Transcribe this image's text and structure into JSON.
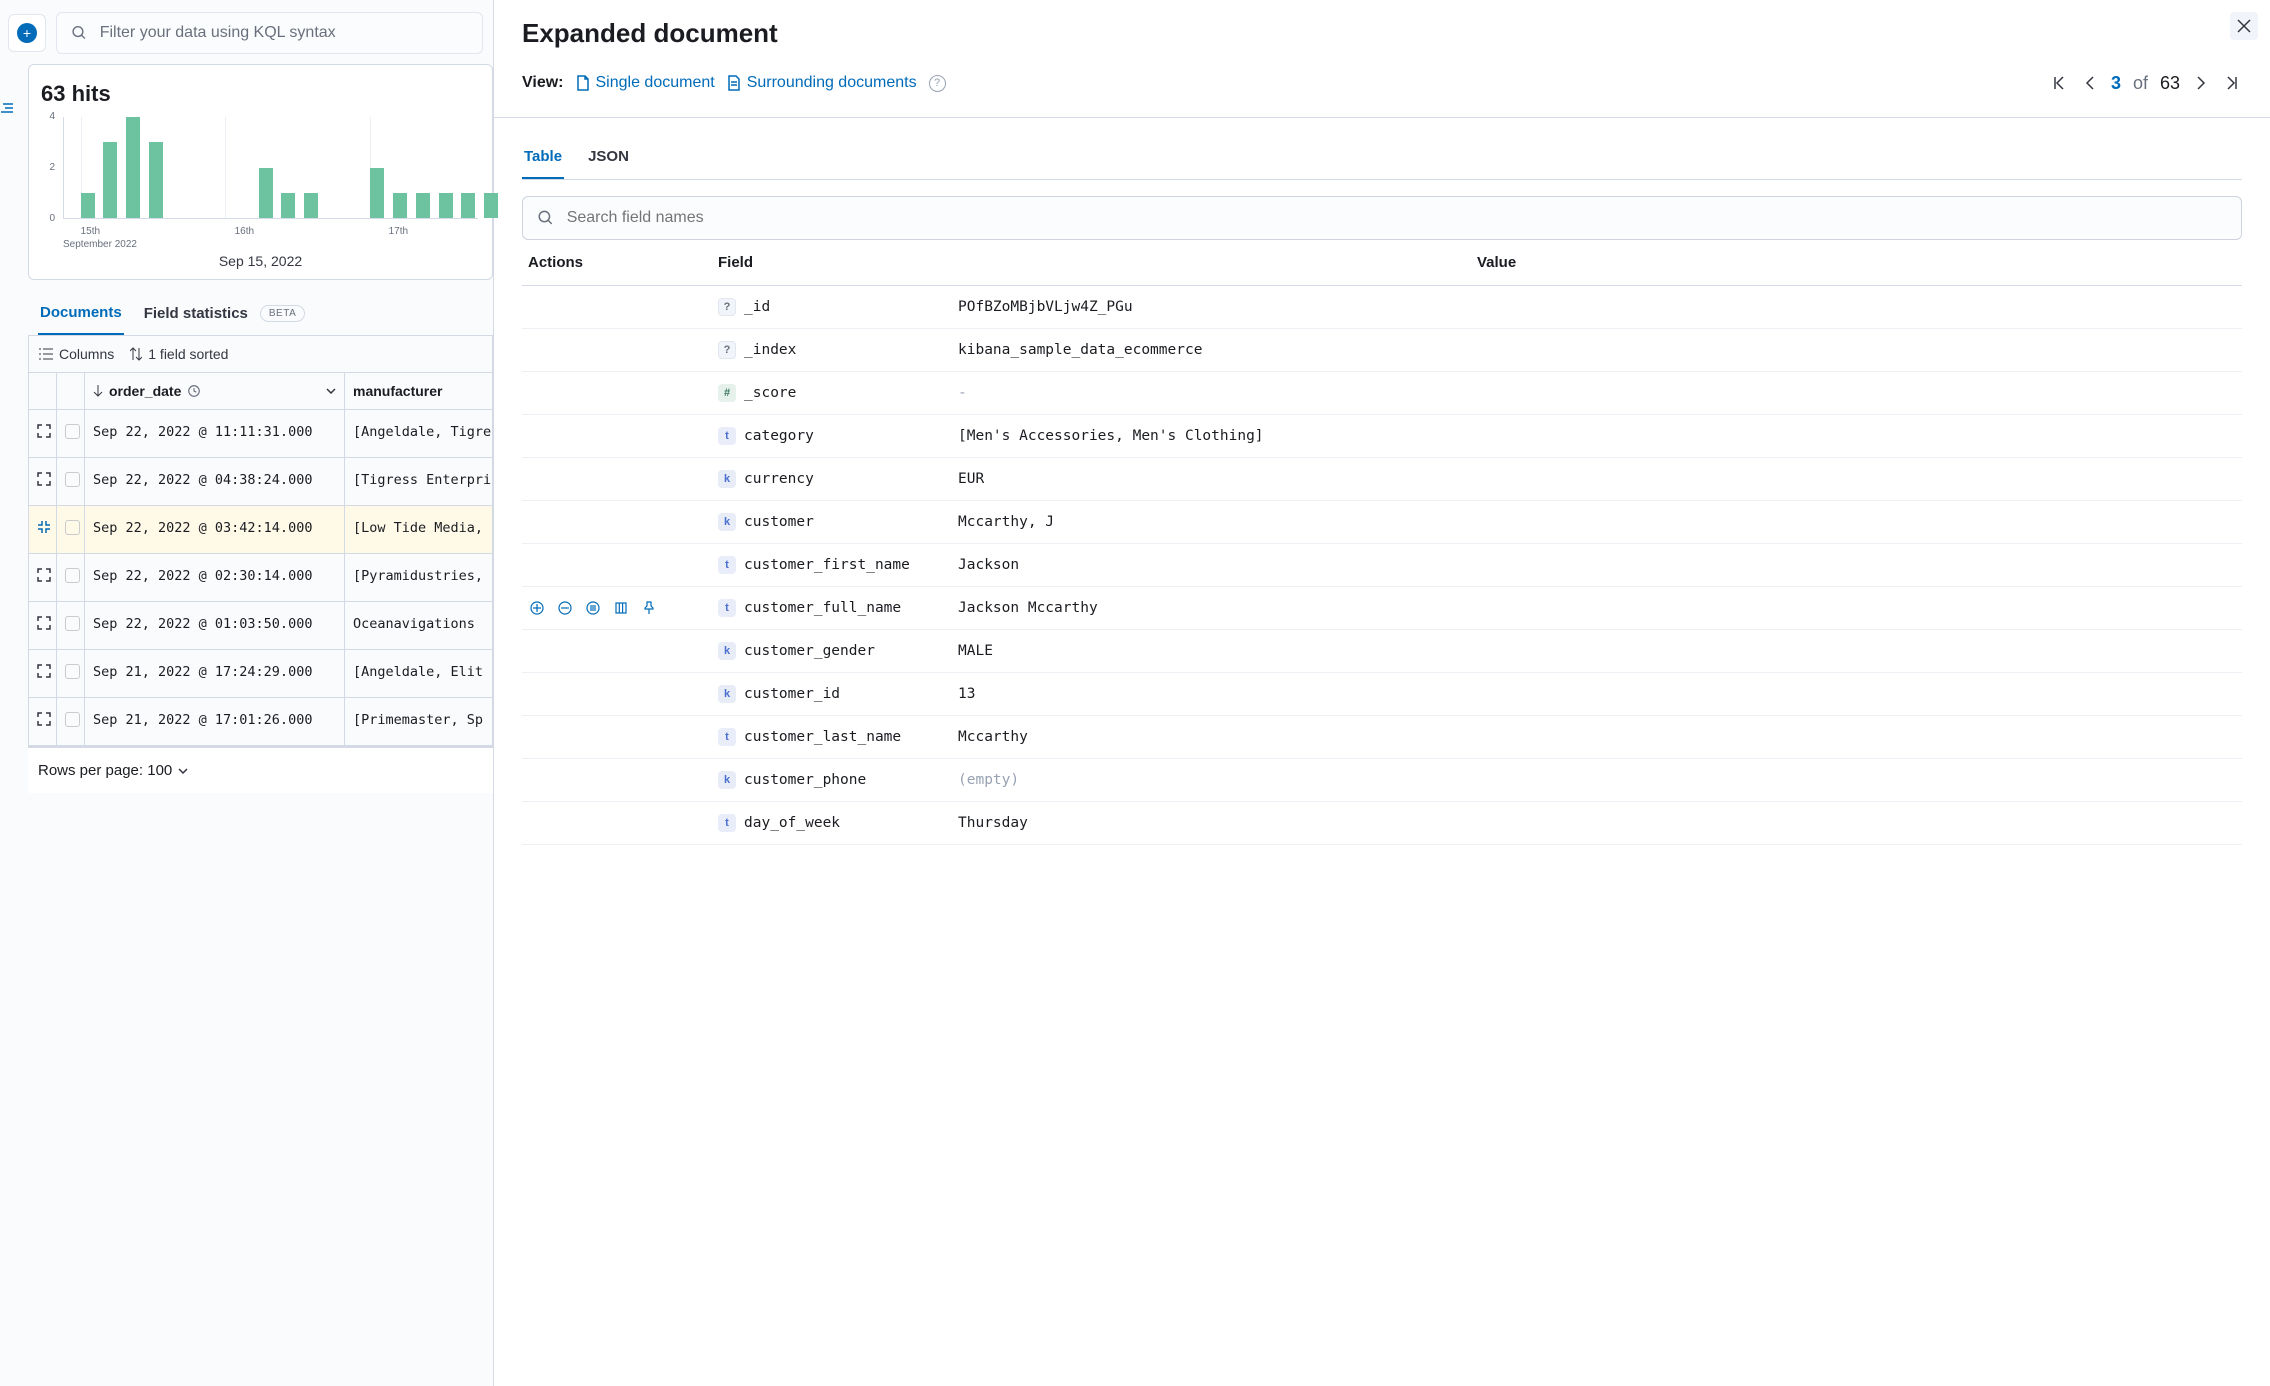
{
  "topbar": {
    "kql_placeholder": "Filter your data using KQL syntax"
  },
  "hits": {
    "count_label": "63 hits"
  },
  "chart_data": {
    "type": "bar",
    "ylim": [
      0,
      4
    ],
    "yticks": [
      0,
      2,
      4
    ],
    "xlabel_sub": "September 2022",
    "xticks": [
      "15th",
      "16th",
      "17th"
    ],
    "xtick_pos_pct": [
      4,
      39,
      74
    ],
    "grid_pos_pct": [
      4,
      39,
      74
    ],
    "bar_pos_pct": [
      4,
      9.5,
      15,
      20.5,
      47,
      52.5,
      58,
      74,
      79.5,
      85,
      90.5,
      96,
      101.5
    ],
    "values": [
      1,
      3,
      4,
      3,
      2,
      1,
      1,
      2,
      1,
      1,
      1,
      1,
      1
    ],
    "caption": "Sep 15, 2022"
  },
  "tabs": {
    "documents": "Documents",
    "field_stats": "Field statistics",
    "beta": "BETA"
  },
  "grid_tools": {
    "columns": "Columns",
    "sorted": "1 field sorted"
  },
  "cols": {
    "order_date": "order_date",
    "manufacturer": "manufacturer"
  },
  "rows": [
    {
      "expanded": false,
      "date": "Sep 22, 2022 @ 11:11:31.000",
      "manu": "[Angeldale, Tigress Enterprises]"
    },
    {
      "expanded": false,
      "date": "Sep 22, 2022 @ 04:38:24.000",
      "manu": "[Tigress Enterprises, Tigress Enterprises, Gnomehouse]"
    },
    {
      "expanded": true,
      "date": "Sep 22, 2022 @ 03:42:14.000",
      "manu": "[Low Tide Media, Elitelligence]"
    },
    {
      "expanded": false,
      "date": "Sep 22, 2022 @ 02:30:14.000",
      "manu": "[Pyramidustries, Lighting]"
    },
    {
      "expanded": false,
      "date": "Sep 22, 2022 @ 01:03:50.000",
      "manu": "Oceanavigations"
    },
    {
      "expanded": false,
      "date": "Sep 21, 2022 @ 17:24:29.000",
      "manu": "[Angeldale, Elit"
    },
    {
      "expanded": false,
      "date": "Sep 21, 2022 @ 17:01:26.000",
      "manu": "[Primemaster, Sp"
    }
  ],
  "footer": {
    "rows_per_page": "Rows per page: 100"
  },
  "flyout": {
    "title": "Expanded document",
    "view_label": "View:",
    "single_doc": "Single document",
    "surrounding": "Surrounding documents",
    "page_current": "3",
    "page_of": "of",
    "page_total": "63",
    "tab_table": "Table",
    "tab_json": "JSON",
    "search_placeholder": "Search field names",
    "hdr_actions": "Actions",
    "hdr_field": "Field",
    "hdr_value": "Value",
    "fields": [
      {
        "type": "q",
        "name": "_id",
        "value": "POfBZoMBjbVLjw4Z_PGu",
        "actions": false
      },
      {
        "type": "q",
        "name": "_index",
        "value": "kibana_sample_data_ecommerce",
        "actions": false
      },
      {
        "type": "hash",
        "name": "_score",
        "value": "-",
        "actions": false,
        "muted": true
      },
      {
        "type": "t",
        "name": "category",
        "value": "[Men's Accessories, Men's Clothing]",
        "actions": false
      },
      {
        "type": "k",
        "name": "currency",
        "value": "EUR",
        "actions": false
      },
      {
        "type": "k",
        "name": "customer",
        "value": "Mccarthy, J",
        "actions": false
      },
      {
        "type": "t",
        "name": "customer_first_name",
        "value": "Jackson",
        "actions": false
      },
      {
        "type": "t",
        "name": "customer_full_name",
        "value": "Jackson Mccarthy",
        "actions": true
      },
      {
        "type": "k",
        "name": "customer_gender",
        "value": "MALE",
        "actions": false
      },
      {
        "type": "k",
        "name": "customer_id",
        "value": "13",
        "actions": false
      },
      {
        "type": "t",
        "name": "customer_last_name",
        "value": "Mccarthy",
        "actions": false
      },
      {
        "type": "k",
        "name": "customer_phone",
        "value": "(empty)",
        "actions": false,
        "muted": true
      },
      {
        "type": "t",
        "name": "day_of_week",
        "value": "Thursday",
        "actions": false
      }
    ]
  }
}
